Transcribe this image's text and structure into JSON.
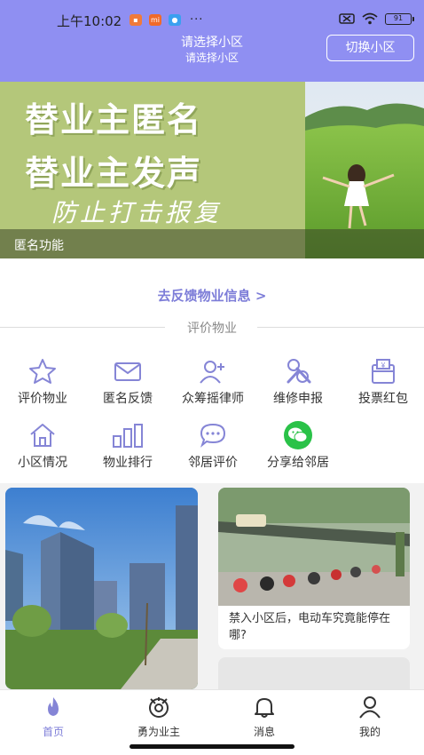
{
  "status_bar": {
    "time": "上午10:02",
    "battery": "91"
  },
  "header": {
    "title": "请选择小区",
    "subtitle": "请选择小区",
    "switch_label": "切换小区",
    "bg_color": "#8f8ff2"
  },
  "banner": {
    "line1": "替业主匿名",
    "line2": "替业主发声",
    "line3": "防止打击报复",
    "caption": "匿名功能"
  },
  "feedback_link": "去反馈物业信息 >",
  "section_title": "评价物业",
  "grid": [
    {
      "label": "评价物业",
      "icon": "star-icon"
    },
    {
      "label": "匿名反馈",
      "icon": "mail-icon"
    },
    {
      "label": "众筹摇律师",
      "icon": "add-person-icon"
    },
    {
      "label": "维修申报",
      "icon": "wrench-icon"
    },
    {
      "label": "投票红包",
      "icon": "vote-box-icon"
    },
    {
      "label": "小区情况",
      "icon": "home-icon"
    },
    {
      "label": "物业排行",
      "icon": "ranking-icon"
    },
    {
      "label": "邻居评价",
      "icon": "chat-icon"
    },
    {
      "label": "分享给邻居",
      "icon": "wechat-icon"
    }
  ],
  "feed": {
    "card2_title": "禁入小区后，电动车究竟能停在哪?"
  },
  "tabbar": [
    {
      "label": "首页",
      "icon": "flame-icon",
      "active": true
    },
    {
      "label": "勇为业主",
      "icon": "owner-badge-icon",
      "active": false
    },
    {
      "label": "消息",
      "icon": "bell-icon",
      "active": false
    },
    {
      "label": "我的",
      "icon": "user-icon",
      "active": false
    }
  ],
  "accent_color": "#7d7dd8"
}
